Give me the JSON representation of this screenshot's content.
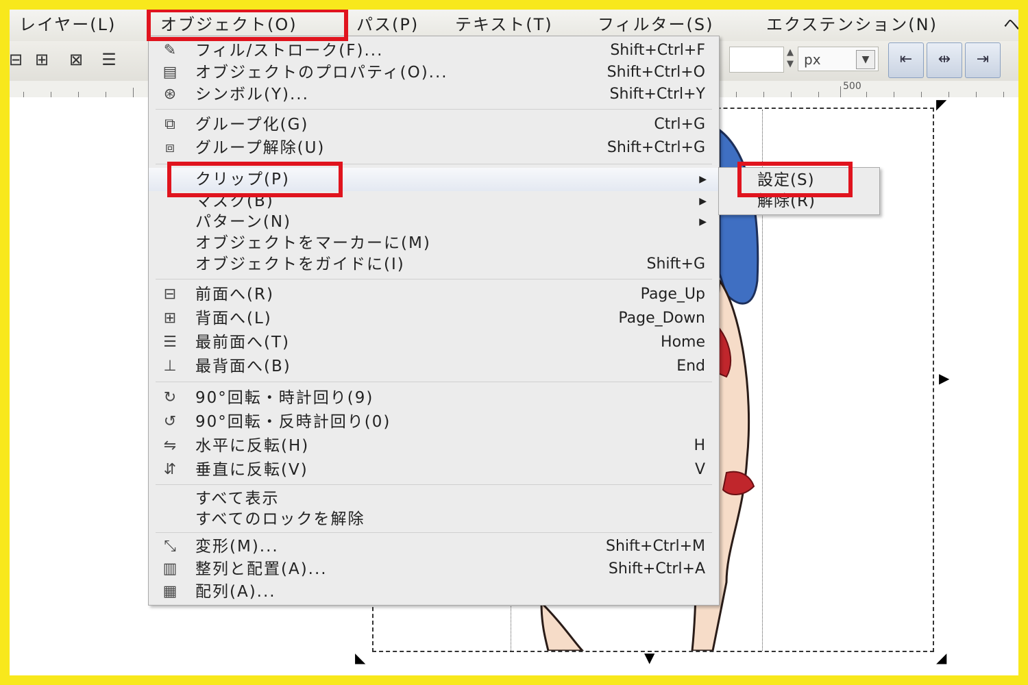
{
  "menubar": {
    "items": [
      {
        "label": "レイヤー(L)"
      },
      {
        "label": "オブジェクト(O)"
      },
      {
        "label": "パス(P)"
      },
      {
        "label": "テキスト(T)"
      },
      {
        "label": "フィルター(S)"
      },
      {
        "label": "エクステンション(N)"
      },
      {
        "label": "ヘ"
      }
    ]
  },
  "toolbar": {
    "unit": "px",
    "ruler_label": "500"
  },
  "object_menu": {
    "items": [
      {
        "label": "フィル/ストローク(F)...",
        "shortcut": "Shift+Ctrl+F",
        "icon": "fill-stroke-icon"
      },
      {
        "label": "オブジェクトのプロパティ(O)...",
        "shortcut": "Shift+Ctrl+O",
        "icon": "object-properties-icon"
      },
      {
        "label": "シンボル(Y)...",
        "shortcut": "Shift+Ctrl+Y",
        "icon": "symbols-icon"
      },
      {
        "label": "グループ化(G)",
        "shortcut": "Ctrl+G",
        "icon": "group-icon"
      },
      {
        "label": "グループ解除(U)",
        "shortcut": "Shift+Ctrl+G",
        "icon": "ungroup-icon"
      },
      {
        "label": "クリップ(P)",
        "shortcut": "",
        "icon": ""
      },
      {
        "label": "マスク(B)",
        "shortcut": "",
        "icon": ""
      },
      {
        "label": "パターン(N)",
        "shortcut": "",
        "icon": ""
      },
      {
        "label": "オブジェクトをマーカーに(M)",
        "shortcut": "",
        "icon": ""
      },
      {
        "label": "オブジェクトをガイドに(I)",
        "shortcut": "Shift+G",
        "icon": ""
      },
      {
        "label": "前面へ(R)",
        "shortcut": "Page_Up",
        "icon": "raise-icon"
      },
      {
        "label": "背面へ(L)",
        "shortcut": "Page_Down",
        "icon": "lower-icon"
      },
      {
        "label": "最前面へ(T)",
        "shortcut": "Home",
        "icon": "raise-to-top-icon"
      },
      {
        "label": "最背面へ(B)",
        "shortcut": "End",
        "icon": "lower-to-bottom-icon"
      },
      {
        "label": "90°回転・時計回り(9)",
        "shortcut": "",
        "icon": "rotate-cw-icon"
      },
      {
        "label": "90°回転・反時計回り(0)",
        "shortcut": "",
        "icon": "rotate-ccw-icon"
      },
      {
        "label": "水平に反転(H)",
        "shortcut": "H",
        "icon": "flip-horizontal-icon"
      },
      {
        "label": "垂直に反転(V)",
        "shortcut": "V",
        "icon": "flip-vertical-icon"
      },
      {
        "label": "すべて表示",
        "shortcut": "",
        "icon": ""
      },
      {
        "label": "すべてのロックを解除",
        "shortcut": "",
        "icon": ""
      },
      {
        "label": "変形(M)...",
        "shortcut": "Shift+Ctrl+M",
        "icon": "transform-icon"
      },
      {
        "label": "整列と配置(A)...",
        "shortcut": "Shift+Ctrl+A",
        "icon": "align-distribute-icon"
      },
      {
        "label": "配列(A)...",
        "shortcut": "",
        "icon": "arrange-icon"
      }
    ]
  },
  "clip_submenu": {
    "items": [
      {
        "label": "設定(S)"
      },
      {
        "label": "解除(R)"
      }
    ]
  },
  "colors": {
    "frame": "#f8e81c",
    "highlight_box": "#e0141e"
  }
}
